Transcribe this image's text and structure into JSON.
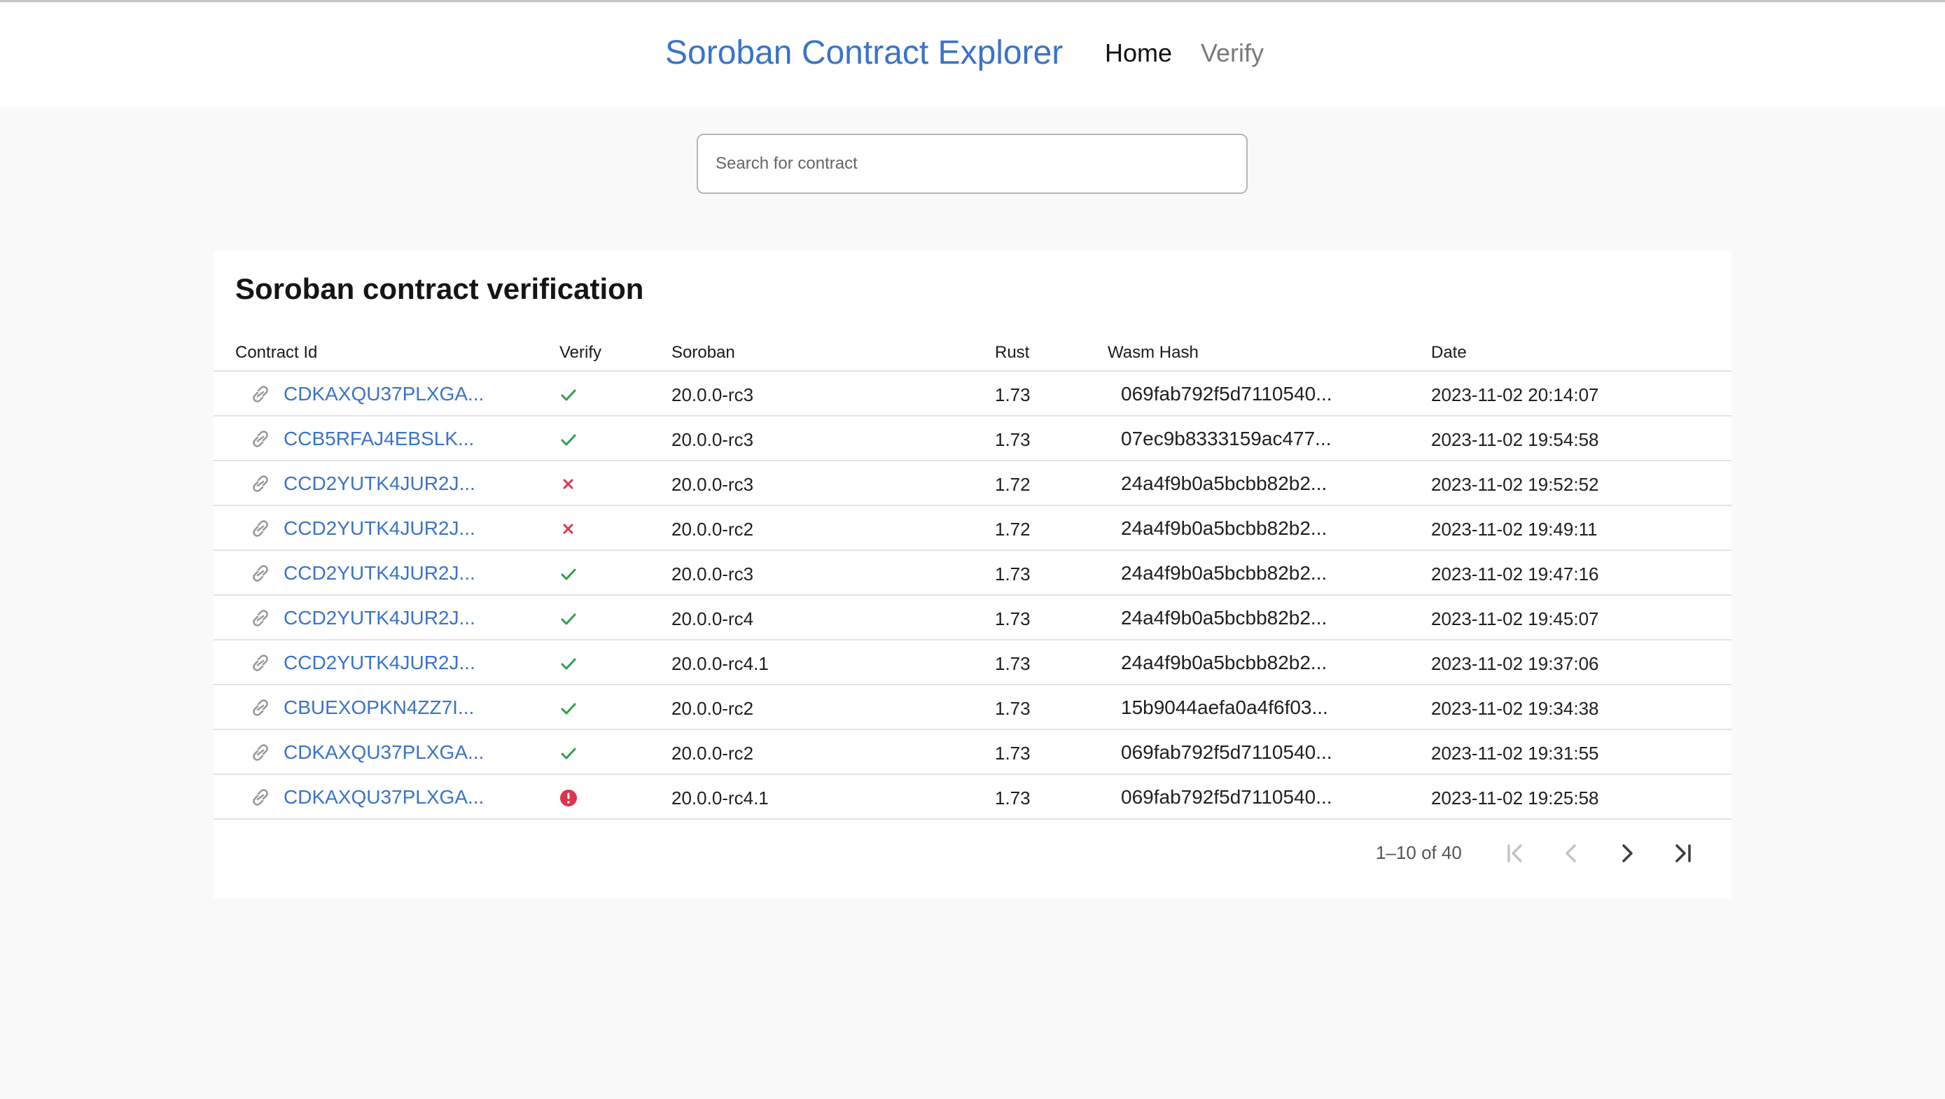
{
  "header": {
    "title": "Soroban Contract Explorer",
    "nav": [
      {
        "label": "Home",
        "active": true
      },
      {
        "label": "Verify",
        "active": false
      }
    ]
  },
  "search": {
    "placeholder": "Search for contract",
    "value": ""
  },
  "card": {
    "title": "Soroban contract verification"
  },
  "table": {
    "columns": [
      "Contract Id",
      "Verify",
      "Soroban",
      "Rust",
      "Wasm Hash",
      "Date"
    ],
    "rows": [
      {
        "contract_id": "CDKAXQU37PLXGA...",
        "verify": "success",
        "soroban": "20.0.0-rc3",
        "rust": "1.73",
        "wasm_hash": "069fab792f5d7110540...",
        "date": "2023-11-02 20:14:07"
      },
      {
        "contract_id": "CCB5RFAJ4EBSLK...",
        "verify": "success",
        "soroban": "20.0.0-rc3",
        "rust": "1.73",
        "wasm_hash": "07ec9b8333159ac477...",
        "date": "2023-11-02 19:54:58"
      },
      {
        "contract_id": "CCD2YUTK4JUR2J...",
        "verify": "failed",
        "soroban": "20.0.0-rc3",
        "rust": "1.72",
        "wasm_hash": "24a4f9b0a5bcbb82b2...",
        "date": "2023-11-02 19:52:52"
      },
      {
        "contract_id": "CCD2YUTK4JUR2J...",
        "verify": "failed",
        "soroban": "20.0.0-rc2",
        "rust": "1.72",
        "wasm_hash": "24a4f9b0a5bcbb82b2...",
        "date": "2023-11-02 19:49:11"
      },
      {
        "contract_id": "CCD2YUTK4JUR2J...",
        "verify": "success",
        "soroban": "20.0.0-rc3",
        "rust": "1.73",
        "wasm_hash": "24a4f9b0a5bcbb82b2...",
        "date": "2023-11-02 19:47:16"
      },
      {
        "contract_id": "CCD2YUTK4JUR2J...",
        "verify": "success",
        "soroban": "20.0.0-rc4",
        "rust": "1.73",
        "wasm_hash": "24a4f9b0a5bcbb82b2...",
        "date": "2023-11-02 19:45:07"
      },
      {
        "contract_id": "CCD2YUTK4JUR2J...",
        "verify": "success",
        "soroban": "20.0.0-rc4.1",
        "rust": "1.73",
        "wasm_hash": "24a4f9b0a5bcbb82b2...",
        "date": "2023-11-02 19:37:06"
      },
      {
        "contract_id": "CBUEXOPKN4ZZ7I...",
        "verify": "success",
        "soroban": "20.0.0-rc2",
        "rust": "1.73",
        "wasm_hash": "15b9044aefa0a4f6f03...",
        "date": "2023-11-02 19:34:38"
      },
      {
        "contract_id": "CDKAXQU37PLXGA...",
        "verify": "success",
        "soroban": "20.0.0-rc2",
        "rust": "1.73",
        "wasm_hash": "069fab792f5d7110540...",
        "date": "2023-11-02 19:31:55"
      },
      {
        "contract_id": "CDKAXQU37PLXGA...",
        "verify": "error",
        "soroban": "20.0.0-rc4.1",
        "rust": "1.73",
        "wasm_hash": "069fab792f5d7110540...",
        "date": "2023-11-02 19:25:58"
      }
    ]
  },
  "pagination": {
    "range": "1–10 of 40",
    "first_disabled": true,
    "prev_disabled": true,
    "next_disabled": false,
    "last_disabled": false
  },
  "icons": {
    "row_link": "link-icon",
    "success": "check-icon",
    "failed": "cross-icon",
    "error": "alert-circle-icon"
  },
  "colors": {
    "brand": "#3b73c8",
    "link": "#3b73c8",
    "success": "#2e9e4f",
    "failed": "#d9364f",
    "error": "#d9364f",
    "muted_text": "#7a7a7a"
  }
}
